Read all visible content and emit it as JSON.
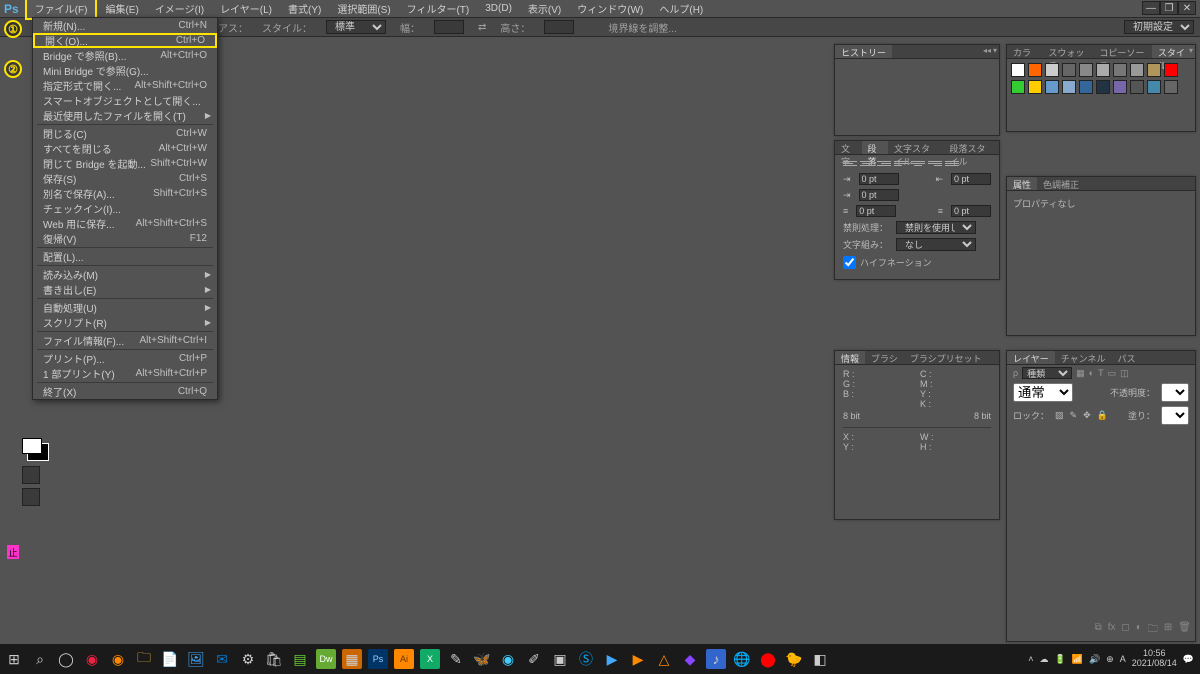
{
  "app": {
    "logo": "Ps"
  },
  "menubar": {
    "items": [
      {
        "label": "ファイル(F)"
      },
      {
        "label": "編集(E)"
      },
      {
        "label": "イメージ(I)"
      },
      {
        "label": "レイヤー(L)"
      },
      {
        "label": "書式(Y)"
      },
      {
        "label": "選択範囲(S)"
      },
      {
        "label": "フィルター(T)"
      },
      {
        "label": "3D(D)"
      },
      {
        "label": "表示(V)"
      },
      {
        "label": "ウィンドウ(W)"
      },
      {
        "label": "ヘルプ(H)"
      }
    ]
  },
  "callouts": {
    "one": "①",
    "two": "②"
  },
  "optionsbar": {
    "antialias": "リアス：",
    "style_label": "スタイル：",
    "style_value": "標準",
    "width_label": "幅：",
    "swap": "⇄",
    "height_label": "高さ：",
    "refine": "境界線を調整...",
    "workspace": "初期設定"
  },
  "file_menu": {
    "groups": [
      [
        {
          "label": "新規(N)...",
          "shortcut": "Ctrl+N"
        },
        {
          "label": "開く(O)...",
          "shortcut": "Ctrl+O",
          "hl": true
        },
        {
          "label": "Bridge で参照(B)...",
          "shortcut": "Alt+Ctrl+O"
        },
        {
          "label": "Mini Bridge で参照(G)..."
        },
        {
          "label": "指定形式で開く...",
          "shortcut": "Alt+Shift+Ctrl+O"
        },
        {
          "label": "スマートオブジェクトとして開く..."
        },
        {
          "label": "最近使用したファイルを開く(T)",
          "arrow": true
        }
      ],
      [
        {
          "label": "閉じる(C)",
          "shortcut": "Ctrl+W"
        },
        {
          "label": "すべてを閉じる",
          "shortcut": "Alt+Ctrl+W"
        },
        {
          "label": "閉じて Bridge を起動...",
          "shortcut": "Shift+Ctrl+W"
        },
        {
          "label": "保存(S)",
          "shortcut": "Ctrl+S"
        },
        {
          "label": "別名で保存(A)...",
          "shortcut": "Shift+Ctrl+S"
        },
        {
          "label": "チェックイン(I)..."
        },
        {
          "label": "Web 用に保存...",
          "shortcut": "Alt+Shift+Ctrl+S"
        },
        {
          "label": "復帰(V)",
          "shortcut": "F12"
        }
      ],
      [
        {
          "label": "配置(L)..."
        }
      ],
      [
        {
          "label": "読み込み(M)",
          "arrow": true
        },
        {
          "label": "書き出し(E)",
          "arrow": true
        }
      ],
      [
        {
          "label": "自動処理(U)",
          "arrow": true
        },
        {
          "label": "スクリプト(R)",
          "arrow": true
        }
      ],
      [
        {
          "label": "ファイル情報(F)...",
          "shortcut": "Alt+Shift+Ctrl+I"
        }
      ],
      [
        {
          "label": "プリント(P)...",
          "shortcut": "Ctrl+P"
        },
        {
          "label": "1 部プリント(Y)",
          "shortcut": "Alt+Shift+Ctrl+P"
        }
      ],
      [
        {
          "label": "終了(X)",
          "shortcut": "Ctrl+Q"
        }
      ]
    ]
  },
  "history_panel": {
    "tab": "ヒストリー"
  },
  "styles_panel": {
    "tabs": {
      "color": "カラー",
      "swatch": "スウォッチ",
      "copysrc": "コピーソース",
      "styles": "スタイル"
    },
    "swatches": [
      "#ffffff",
      "#ff6600",
      "#cccccc",
      "#666666",
      "#888888",
      "#aaaaaa",
      "#777777",
      "#999999",
      "#b0965a",
      "#ff0000",
      "#33cc33",
      "#ffcc00",
      "#6699cc",
      "#88aacc",
      "#336699",
      "#223344",
      "#7766aa",
      "#555555",
      "#4488aa",
      "#666666"
    ]
  },
  "paragraph_panel": {
    "tabs": {
      "char": "文字",
      "para": "段落",
      "charstyle": "文字スタイル",
      "parastyle": "段落スタイル"
    },
    "values": {
      "v1": "0 pt",
      "v2": "0 pt",
      "v3": "0 pt",
      "v4": "0 pt",
      "v5": "0 pt"
    },
    "kinsoku_label": "禁則処理：",
    "kinsoku_value": "禁則を使用しない",
    "mojikumi_label": "文字組み：",
    "mojikumi_value": "なし",
    "hyphenation": "ハイフネーション"
  },
  "properties_panel": {
    "tabs": {
      "attr": "属性",
      "coloradj": "色調補正"
    },
    "body": "プロパティなし"
  },
  "info_panel": {
    "tabs": {
      "info": "情報",
      "brush": "ブラシ",
      "brushpreset": "ブラシプリセット"
    },
    "rows": {
      "r": "R :",
      "g": "G :",
      "b": "B :",
      "c": "C :",
      "m": "M :",
      "y": "Y :",
      "k": "K :",
      "bit1": "8 bit",
      "bit2": "8 bit",
      "x": "X :",
      "y2": "Y :",
      "w": "W :",
      "h": "H :"
    }
  },
  "layers_panel": {
    "tabs": {
      "layers": "レイヤー",
      "channels": "チャンネル",
      "paths": "パス"
    },
    "kind": "種類",
    "blend": "通常",
    "opacity_label": "不透明度：",
    "lock_label": "ロック：",
    "fill_label": "塗り："
  },
  "taskbar": {
    "clock_time": "10:56",
    "clock_date": "2021/08/14"
  },
  "pink": "止"
}
